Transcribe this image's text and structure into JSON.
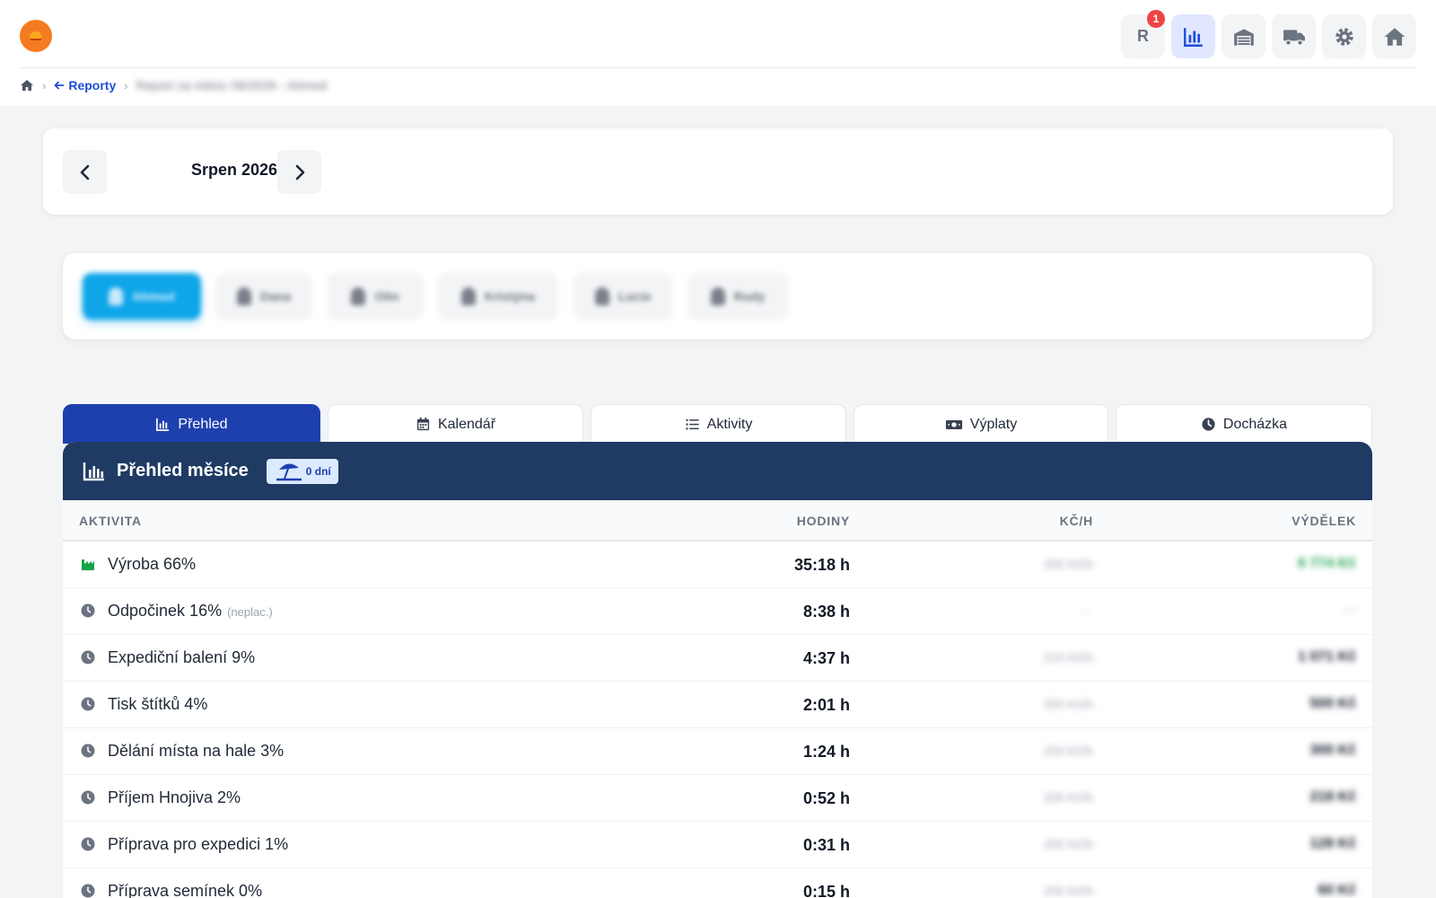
{
  "header": {
    "user_initial": "R",
    "notification_count": "1",
    "nav_icons": [
      "reports-icon",
      "warehouse-icon",
      "truck-icon",
      "gear-icon",
      "home-icon"
    ],
    "active_nav": "reports-icon"
  },
  "breadcrumb": {
    "back_label": "Reporty",
    "current": "Report za měsíc 08/2026 - Ahmed"
  },
  "month": {
    "title": "Srpen 2026"
  },
  "people": [
    "Ahmed",
    "Dana",
    "Olin",
    "Kristýna",
    "Lucie",
    "Rudy"
  ],
  "active_person": "Ahmed",
  "tabs": [
    {
      "label": "Přehled",
      "icon": "chart-icon",
      "active": true
    },
    {
      "label": "Kalendář",
      "icon": "calendar-icon",
      "active": false
    },
    {
      "label": "Aktivity",
      "icon": "list-icon",
      "active": false
    },
    {
      "label": "Výplaty",
      "icon": "money-icon",
      "active": false
    },
    {
      "label": "Docházka",
      "icon": "clock-icon",
      "active": false
    }
  ],
  "summary": {
    "title": "Přehled měsíce",
    "vacation_badge": "0 dní",
    "columns": {
      "activity": "AKTIVITA",
      "hours": "HODINY",
      "rate": "KČ/H",
      "earnings": "VÝDĚLEK"
    },
    "rows": [
      {
        "name": "Výroba 66%",
        "note": "",
        "hours": "35:18 h",
        "rate": "200 Kč/h",
        "earnings": "6 774 Kč",
        "icon": "factory-icon"
      },
      {
        "name": "Odpočinek 16%",
        "note": "(neplac.)",
        "hours": "8:38 h",
        "rate": "—",
        "earnings": "—",
        "icon": "clock-icon"
      },
      {
        "name": "Expediční balení 9%",
        "note": "",
        "hours": "4:37 h",
        "rate": "210 Kč/h",
        "earnings": "1 071 Kč",
        "icon": "clock-icon"
      },
      {
        "name": "Tisk štítků 4%",
        "note": "",
        "hours": "2:01 h",
        "rate": "200 Kč/h",
        "earnings": "500 Kč",
        "icon": "clock-icon"
      },
      {
        "name": "Dělání místa na hale 3%",
        "note": "",
        "hours": "1:24 h",
        "rate": "200 Kč/h",
        "earnings": "300 Kč",
        "icon": "clock-icon"
      },
      {
        "name": "Příjem Hnojiva 2%",
        "note": "",
        "hours": "0:52 h",
        "rate": "200 Kč/h",
        "earnings": "218 Kč",
        "icon": "clock-icon"
      },
      {
        "name": "Příprava pro expedici 1%",
        "note": "",
        "hours": "0:31 h",
        "rate": "200 Kč/h",
        "earnings": "128 Kč",
        "icon": "clock-icon"
      },
      {
        "name": "Příprava semínek 0%",
        "note": "",
        "hours": "0:15 h",
        "rate": "200 Kč/h",
        "earnings": "60 Kč",
        "icon": "clock-icon"
      }
    ]
  },
  "colors": {
    "primary": "#1e40af",
    "panel_header": "#1f3b63",
    "active_person": "#0ea5e9",
    "logo": "#f47b20",
    "earn_positive": "#16a34a",
    "notification": "#ef4444"
  }
}
